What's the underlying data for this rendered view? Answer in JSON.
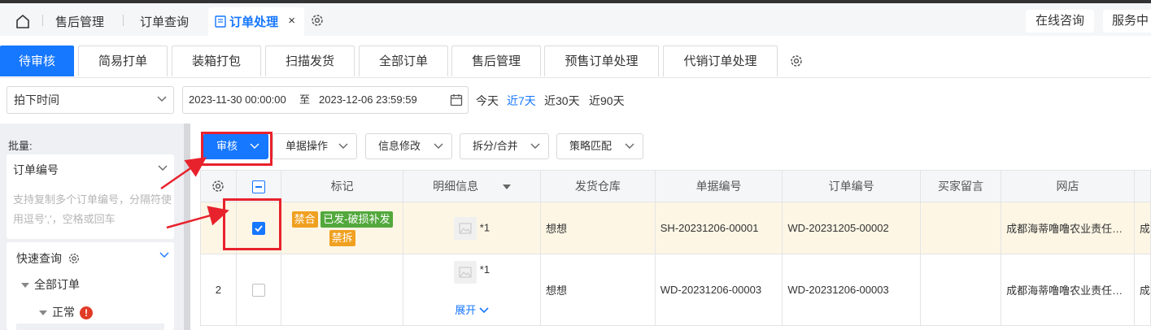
{
  "topnav": {
    "tabs": [
      "售后管理",
      "订单查询"
    ],
    "active_tab": "订单处理",
    "close_glyph": "×",
    "right": [
      "在线咨询",
      "服务中"
    ]
  },
  "tabs": [
    "待审核",
    "简易打单",
    "装箱打包",
    "扫描发货",
    "全部订单",
    "售后管理",
    "预售订单处理",
    "代销订单处理"
  ],
  "filter": {
    "time_type": "拍下时间",
    "start": "2023-11-30 00:00:00",
    "to": "至",
    "end": "2023-12-06 23:59:59",
    "quick": [
      "今天",
      "近7天",
      "近30天",
      "近90天"
    ],
    "quick_active": "近7天"
  },
  "leftpanel": {
    "batch_label": "批量:",
    "field": "订单编号",
    "placeholder": "支持复制多个订单编号，分隔符使用逗号','，空格或回车",
    "quick_query": "快速查询",
    "tree_all": "全部订单",
    "tree_normal": "正常",
    "warn": "!"
  },
  "toolbar": {
    "audit": "审核",
    "doc_ops": "单据操作",
    "info_edit": "信息修改",
    "split_merge": "拆分/合并",
    "strategy": "策略匹配"
  },
  "table": {
    "headers": [
      "标记",
      "明细信息",
      "发货仓库",
      "单据编号",
      "订单编号",
      "买家留言",
      "网店"
    ],
    "rows": [
      {
        "index": "",
        "checked": true,
        "tags": [
          "禁合",
          "已发-破损补发",
          "禁拆"
        ],
        "qty": "*1",
        "warehouse": "想想",
        "doc_no": "SH-20231206-00001",
        "order_no": "WD-20231205-00002",
        "buyer_msg": "",
        "shop": "成都海蒂噜噜农业责任…",
        "extra": "成"
      },
      {
        "index": "2",
        "checked": false,
        "tags": [],
        "qty": "*1",
        "expand": "展开",
        "warehouse": "想想",
        "doc_no": "WD-20231206-00003",
        "order_no": "WD-20231206-00003",
        "buyer_msg": "",
        "shop": "成都海蒂噜噜农业责任…",
        "extra": "成"
      }
    ]
  },
  "colors": {
    "primary": "#1677ff",
    "highlight_red": "#e8222c",
    "tag_orange": "#f0a020",
    "tag_green": "#52a83c"
  }
}
